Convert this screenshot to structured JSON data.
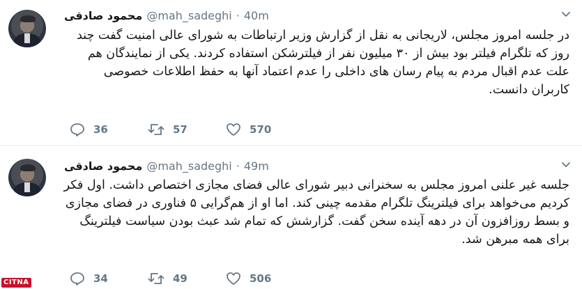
{
  "tweets": [
    {
      "author": {
        "name": "محمود صادقی",
        "handle": "@mah_sadeghi",
        "time": "40m"
      },
      "text": "در جلسه امروز مجلس، لاریجانی به نقل از گزارش وزیر ارتباطات به شورای عالی امنیت گفت چند روز که تلگرام فیلتر بود بیش از ۳۰ میلیون نفر از فیلترشکن استفاده کردند. یکی از نمایندگان هم علت عدم اقبال مردم به پیام رسان های داخلی را عدم اعتماد آنها به حفظ اطلاعات خصوصی کاربران دانست.",
      "stats": {
        "replies": "36",
        "retweets": "57",
        "likes": "570"
      }
    },
    {
      "author": {
        "name": "محمود صادقی",
        "handle": "@mah_sadeghi",
        "time": "49m"
      },
      "text": "جلسه غیر علنی امروز مجلس به سخنرانی دبیر شورای عالی فضای مجازی اختصاص داشت. اول فکر کردیم می‌خواهد برای فیلترینگ تلگرام مقدمه چینی کند. اما او از هم‌گرایی ۵ فناوری در فضای مجازی و بسط روزافزون آن در دهه آینده سخن گفت. گزارشش که تمام شد عبث بودن سیاست فیلترینگ برای همه مبرهن شد.",
      "stats": {
        "replies": "34",
        "retweets": "49",
        "likes": "506"
      }
    }
  ],
  "separator": "·",
  "icons": {
    "reply": "reply-icon",
    "retweet": "retweet-icon",
    "like": "heart-icon",
    "menu": "chevron-down-icon"
  },
  "colors": {
    "meta": "#657786",
    "text": "#14171a",
    "divider": "#e6ecf0",
    "watermark": "#c8102e"
  },
  "watermark": "CITNA"
}
